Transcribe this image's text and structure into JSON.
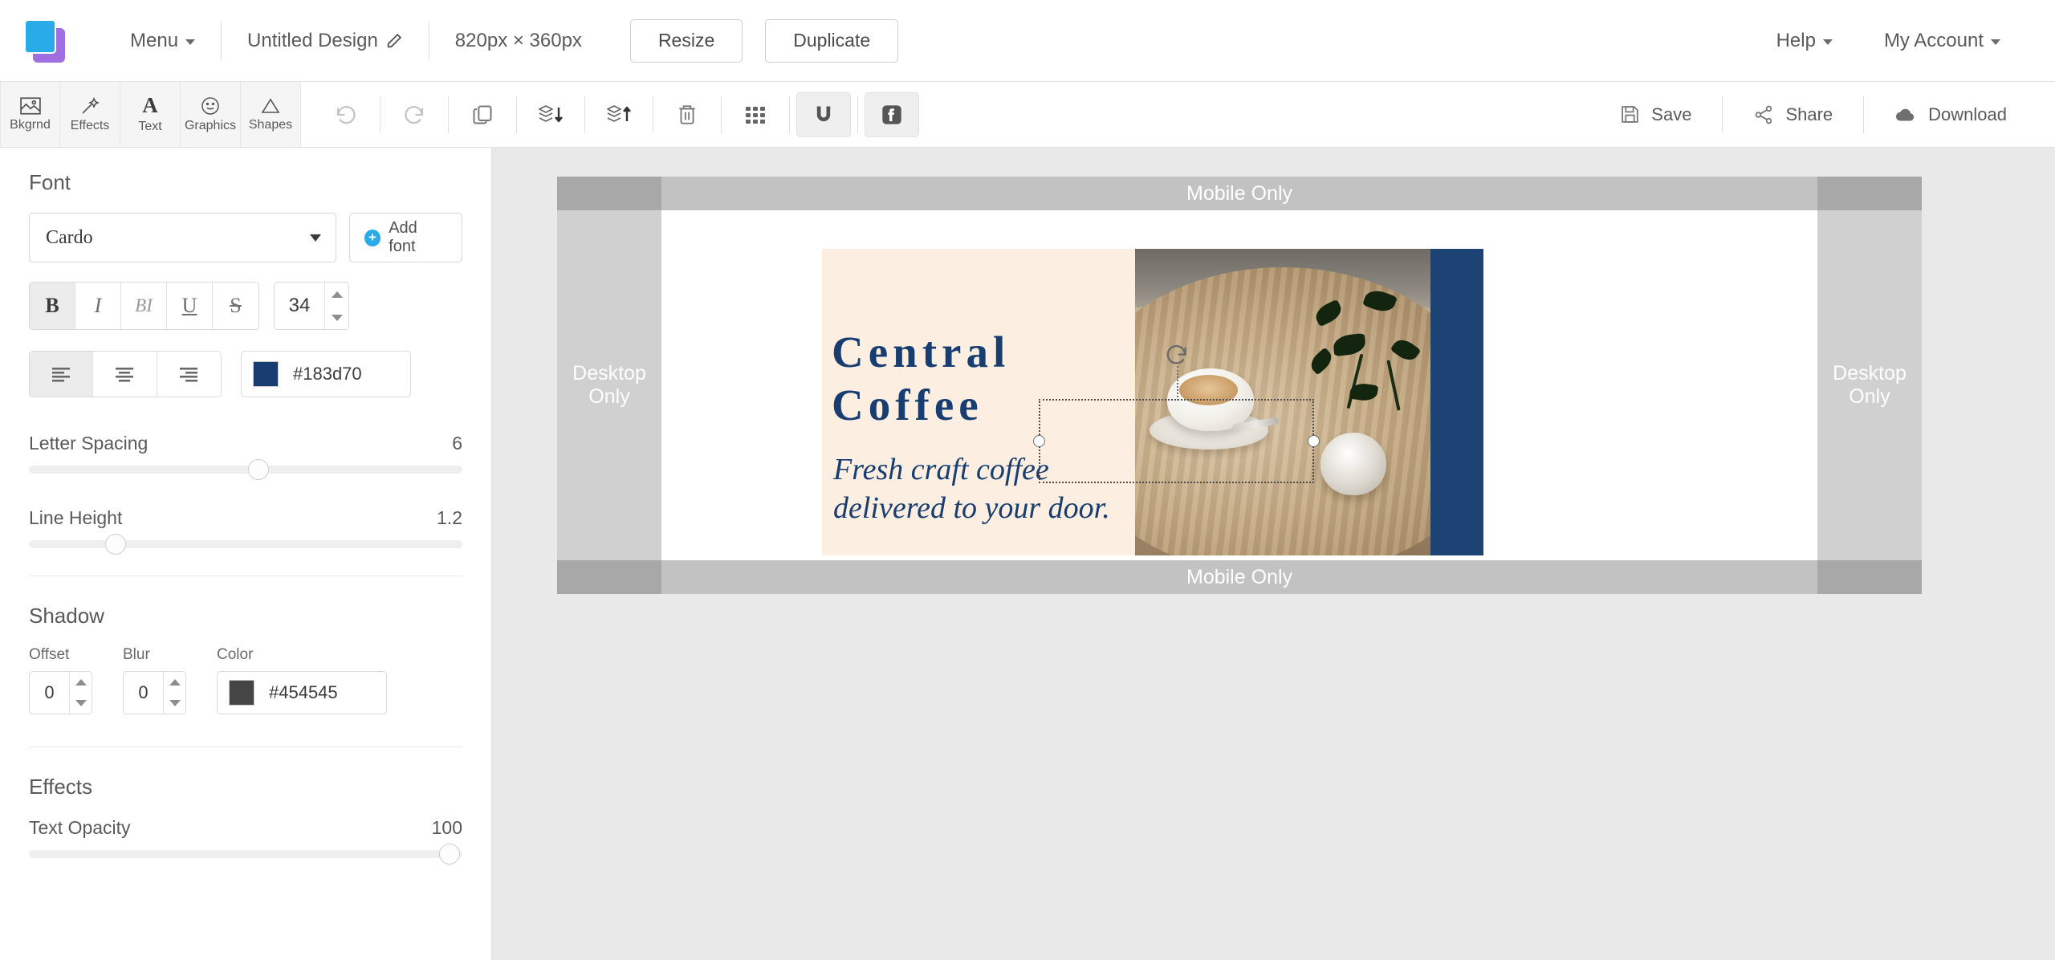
{
  "header": {
    "logo": "app-logo",
    "menu_label": "Menu",
    "design_title": "Untitled Design",
    "dimensions": "820px × 360px",
    "resize_label": "Resize",
    "duplicate_label": "Duplicate",
    "help_label": "Help",
    "account_label": "My Account"
  },
  "toolbar": {
    "tabs": [
      {
        "label": "Bkgrnd",
        "icon": "image-icon"
      },
      {
        "label": "Effects",
        "icon": "magic-wand-icon"
      },
      {
        "label": "Text",
        "icon": "letter-a-icon"
      },
      {
        "label": "Graphics",
        "icon": "smiley-icon"
      },
      {
        "label": "Shapes",
        "icon": "triangle-icon"
      }
    ],
    "actions": [
      {
        "name": "undo",
        "icon": "undo-icon"
      },
      {
        "name": "redo",
        "icon": "redo-icon"
      },
      {
        "name": "duplicate",
        "icon": "copy-icon"
      },
      {
        "name": "send-backward",
        "icon": "layers-down-icon"
      },
      {
        "name": "bring-forward",
        "icon": "layers-up-icon"
      },
      {
        "name": "delete",
        "icon": "trash-icon"
      },
      {
        "name": "grid",
        "icon": "grid-icon"
      },
      {
        "name": "snap",
        "icon": "magnet-icon"
      },
      {
        "name": "facebook",
        "icon": "facebook-icon"
      }
    ],
    "save_label": "Save",
    "share_label": "Share",
    "download_label": "Download"
  },
  "sidebar": {
    "font_section_title": "Font",
    "font_value": "Cardo",
    "add_font_label": "Add font",
    "style_buttons": [
      {
        "label": "B",
        "name": "bold",
        "active": true
      },
      {
        "label": "I",
        "name": "italic",
        "active": false
      },
      {
        "label": "BI",
        "name": "bold-italic",
        "active": false
      },
      {
        "label": "U",
        "name": "underline",
        "active": false
      },
      {
        "label": "S",
        "name": "strikethrough",
        "active": false
      }
    ],
    "font_size": "34",
    "align_options": [
      "left",
      "center",
      "right"
    ],
    "align_active": "left",
    "text_color": "#183d70",
    "letter_spacing_label": "Letter Spacing",
    "letter_spacing_value": "6",
    "letter_spacing_percent": 53,
    "line_height_label": "Line Height",
    "line_height_value": "1.2",
    "line_height_percent": 20,
    "shadow_section_title": "Shadow",
    "shadow_offset_label": "Offset",
    "shadow_offset_value": "0",
    "shadow_blur_label": "Blur",
    "shadow_blur_value": "0",
    "shadow_color_label": "Color",
    "shadow_color": "#454545",
    "effects_section_title": "Effects",
    "text_opacity_label": "Text Opacity",
    "text_opacity_value": "100",
    "text_opacity_percent": 97
  },
  "canvas": {
    "band_top_label": "Mobile Only",
    "band_bottom_label": "Mobile Only",
    "desktop_left_label": "Desktop\nOnly",
    "desktop_right_label": "Desktop\nOnly",
    "headline": "Central Coffee",
    "subline_line1": "Fresh craft coffee",
    "subline_line2": "delivered to your door.",
    "accent_blue": "#1d4374",
    "cream": "#fdeee2",
    "text_color": "#183d70"
  }
}
